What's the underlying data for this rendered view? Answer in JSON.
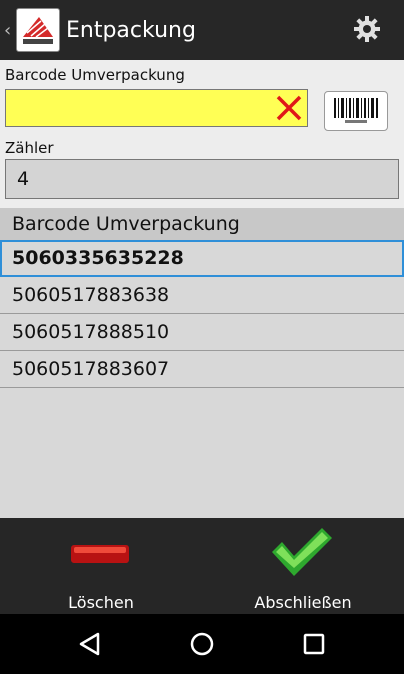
{
  "header": {
    "title": "Entpackung",
    "back_glyph": "‹"
  },
  "form": {
    "barcode_label": "Barcode Umverpackung",
    "barcode_value": "",
    "counter_label": "Zähler",
    "counter_value": "4",
    "input_bg_color": "#ffff55"
  },
  "list": {
    "header": "Barcode Umverpackung",
    "items": [
      "5060335635228",
      "5060517883638",
      "5060517888510",
      "5060517883607"
    ],
    "selected_index": 0
  },
  "actions": {
    "delete_label": "Löschen",
    "finish_label": "Abschließen"
  },
  "icons": {
    "logo": "app-logo",
    "settings": "gear-icon",
    "clear": "red-x-icon",
    "scan": "barcode-icon",
    "delete": "minus-icon",
    "finish": "checkmark-icon"
  }
}
